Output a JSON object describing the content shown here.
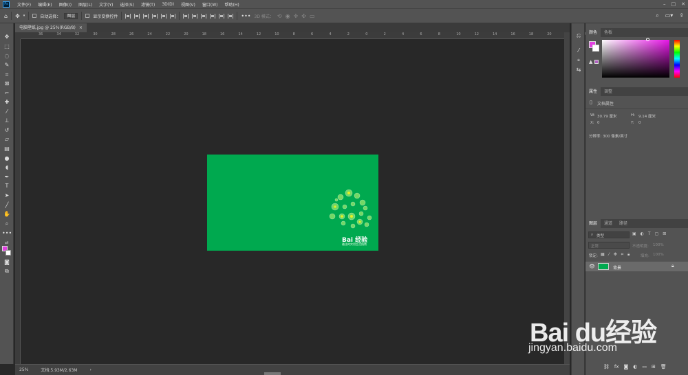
{
  "menubar": {
    "items": [
      "文件(F)",
      "编辑(E)",
      "图像(I)",
      "图层(L)",
      "文字(Y)",
      "选择(S)",
      "滤镜(T)",
      "3D(D)",
      "视图(V)",
      "窗口(W)",
      "帮助(H)"
    ],
    "logo": "Ps"
  },
  "optionsbar": {
    "auto_select_label": "自动选择：",
    "auto_select_value": "图层",
    "show_transform_label": "显示变换控件",
    "mode_3d_label": "3D 模式："
  },
  "document": {
    "tab_title": "电脑壁纸.jpg @ 25%(RGB/8)",
    "tab_close": "×"
  },
  "rulers": {
    "h_labels": [
      "36",
      "34",
      "32",
      "30",
      "28",
      "26",
      "24",
      "22",
      "20",
      "18",
      "16",
      "14",
      "12",
      "10",
      "8",
      "6",
      "4",
      "2",
      "0",
      "2",
      "4",
      "6",
      "8",
      "10",
      "12",
      "14",
      "16",
      "18",
      "20",
      "22",
      "24"
    ]
  },
  "image": {
    "logo_text": "Bai  经验",
    "slogan": "最佳的实用生活指南"
  },
  "status": {
    "zoom": "25%",
    "doc_info": "文档:5.93M/2.63M"
  },
  "color_panel": {
    "tabs": [
      "颜色",
      "色板"
    ],
    "foreground": "#e040e0",
    "background": "#ffffff"
  },
  "properties_panel": {
    "tabs": [
      "属性",
      "调整"
    ],
    "section_title": "文档属性",
    "w_label": "W:",
    "w_value": "30.79 厘米",
    "h_label": "H:",
    "h_value": "9.14 厘米",
    "x_label": "X:",
    "x_value": "0",
    "y_label": "Y:",
    "y_value": "0",
    "resolution": "分辨率: 300 像素/英寸"
  },
  "layers_panel": {
    "tabs": [
      "图层",
      "通道",
      "路径"
    ],
    "filter_label": "类型",
    "blend_mode": "正常",
    "opacity_label": "不透明度:",
    "opacity_value": "100%",
    "lock_label": "锁定:",
    "fill_label": "填充:",
    "fill_value": "100%",
    "layer_name": "背景"
  },
  "watermark": {
    "logo": "Bai du经验",
    "url": "jingyan.baidu.com"
  },
  "colors": {
    "image_green": "#00a94f",
    "ui_gray": "#535353",
    "canvas_bg": "#282828"
  }
}
